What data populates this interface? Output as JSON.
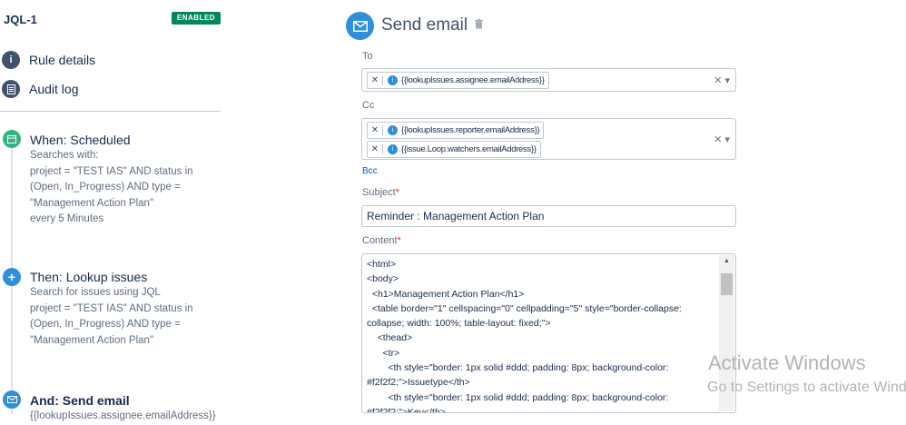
{
  "rule": {
    "name": "JQL-1",
    "status_badge": "ENABLED"
  },
  "nav": [
    {
      "label": "Rule details",
      "icon": "info-icon"
    },
    {
      "label": "Audit log",
      "icon": "document-icon"
    }
  ],
  "steps": [
    {
      "title": "When: Scheduled",
      "icon": "calendar-icon",
      "color": "#36b37e",
      "desc": "Searches with:\nproject = \"TEST IAS\" AND status in\n(Open, In_Progress) AND type =\n\"Management Action Plan\"\nevery 5 Minutes"
    },
    {
      "title": "Then: Lookup issues",
      "icon": "plus-icon",
      "color": "#2f8fd8",
      "desc": "Search for issues using JQL\nproject = \"TEST IAS\" AND status in\n(Open, In_Progress) AND type =\n\"Management Action Plan\""
    },
    {
      "title": "And: Send email",
      "icon": "mail-icon",
      "color": "#2f8fd8",
      "desc": "{{lookupIssues.assignee.emailAddress}}"
    }
  ],
  "action": {
    "title": "Send email",
    "to_label": "To",
    "to": [
      "{{lookupIssues.assignee.emailAddress}}"
    ],
    "cc_label": "Cc",
    "cc": [
      "{{lookupIssues.reporter.emailAddress}}",
      "{{issue.Loop.watchers.emailAddress}}"
    ],
    "bcc_label": "Bcc",
    "subject_label": "Subject",
    "subject": "Reminder : Management Action Plan",
    "content_label": "Content",
    "content": "<html>\n<body>\n  <h1>Management Action Plan</h1>\n  <table border=\"1\" cellspacing=\"0\" cellpadding=\"5\" style=\"border-collapse: collapse; width: 100%; table-layout: fixed;\">\n    <thead>\n      <tr>\n        <th style=\"border: 1px solid #ddd; padding: 8px; background-color: #f2f2f2;\">Issuetype</th>\n        <th style=\"border: 1px solid #ddd; padding: 8px; background-color: #f2f2f2;\">Key</th>"
  },
  "watermark": {
    "line1": "Activate Windows",
    "line2": "Go to Settings to activate Windows."
  }
}
